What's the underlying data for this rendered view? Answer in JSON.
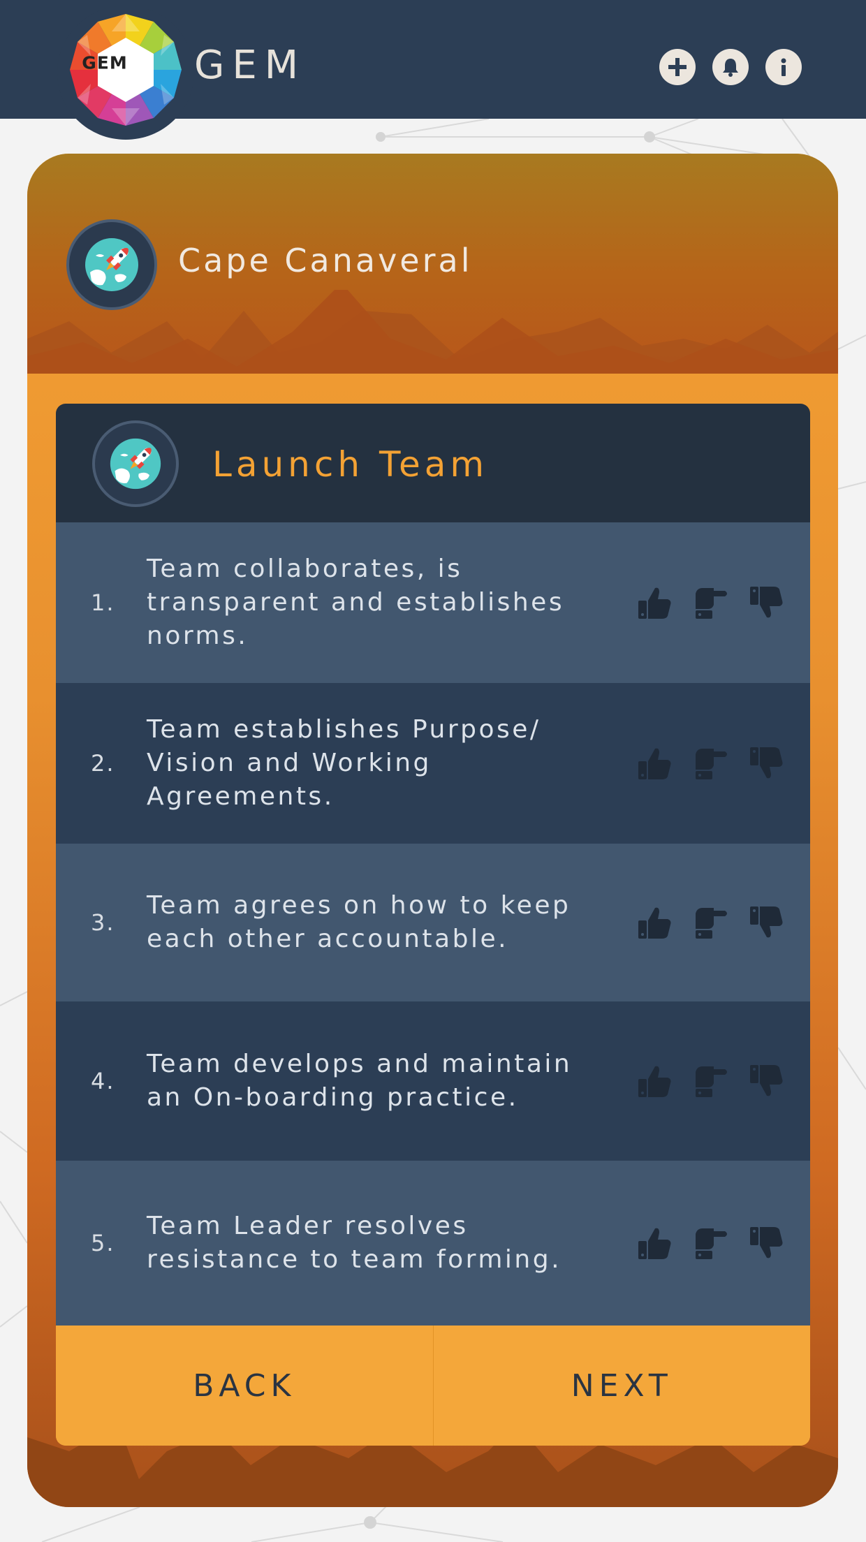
{
  "header": {
    "logo_text": "GEM",
    "app_name": "GEM",
    "icons": [
      "plus-icon",
      "bell-icon",
      "info-icon"
    ]
  },
  "location": {
    "title": "Cape Canaveral",
    "icon": "rocket-globe-icon"
  },
  "team": {
    "title": "Launch Team",
    "icon": "rocket-globe-icon"
  },
  "items": [
    {
      "number": "1.",
      "text": "Team collaborates, is transparent and establishes norms."
    },
    {
      "number": "2.",
      "text": "Team establishes Purpose/ Vision and Working Agreements."
    },
    {
      "number": "3.",
      "text": "Team agrees on how to keep each other accountable."
    },
    {
      "number": "4.",
      "text": "Team develops and maintain an On-boarding practice."
    },
    {
      "number": "5.",
      "text": "Team Leader resolves resistance to team forming."
    }
  ],
  "vote_icons": [
    "thumbs-up-icon",
    "thumbs-sideways-icon",
    "thumbs-down-icon"
  ],
  "nav": {
    "back_label": "BACK",
    "next_label": "NEXT"
  },
  "colors": {
    "header_bg": "#2c3e55",
    "accent": "#f4a234",
    "panel_head": "#243140",
    "row_light": "#42576f",
    "row_dark": "#2c3e55"
  }
}
